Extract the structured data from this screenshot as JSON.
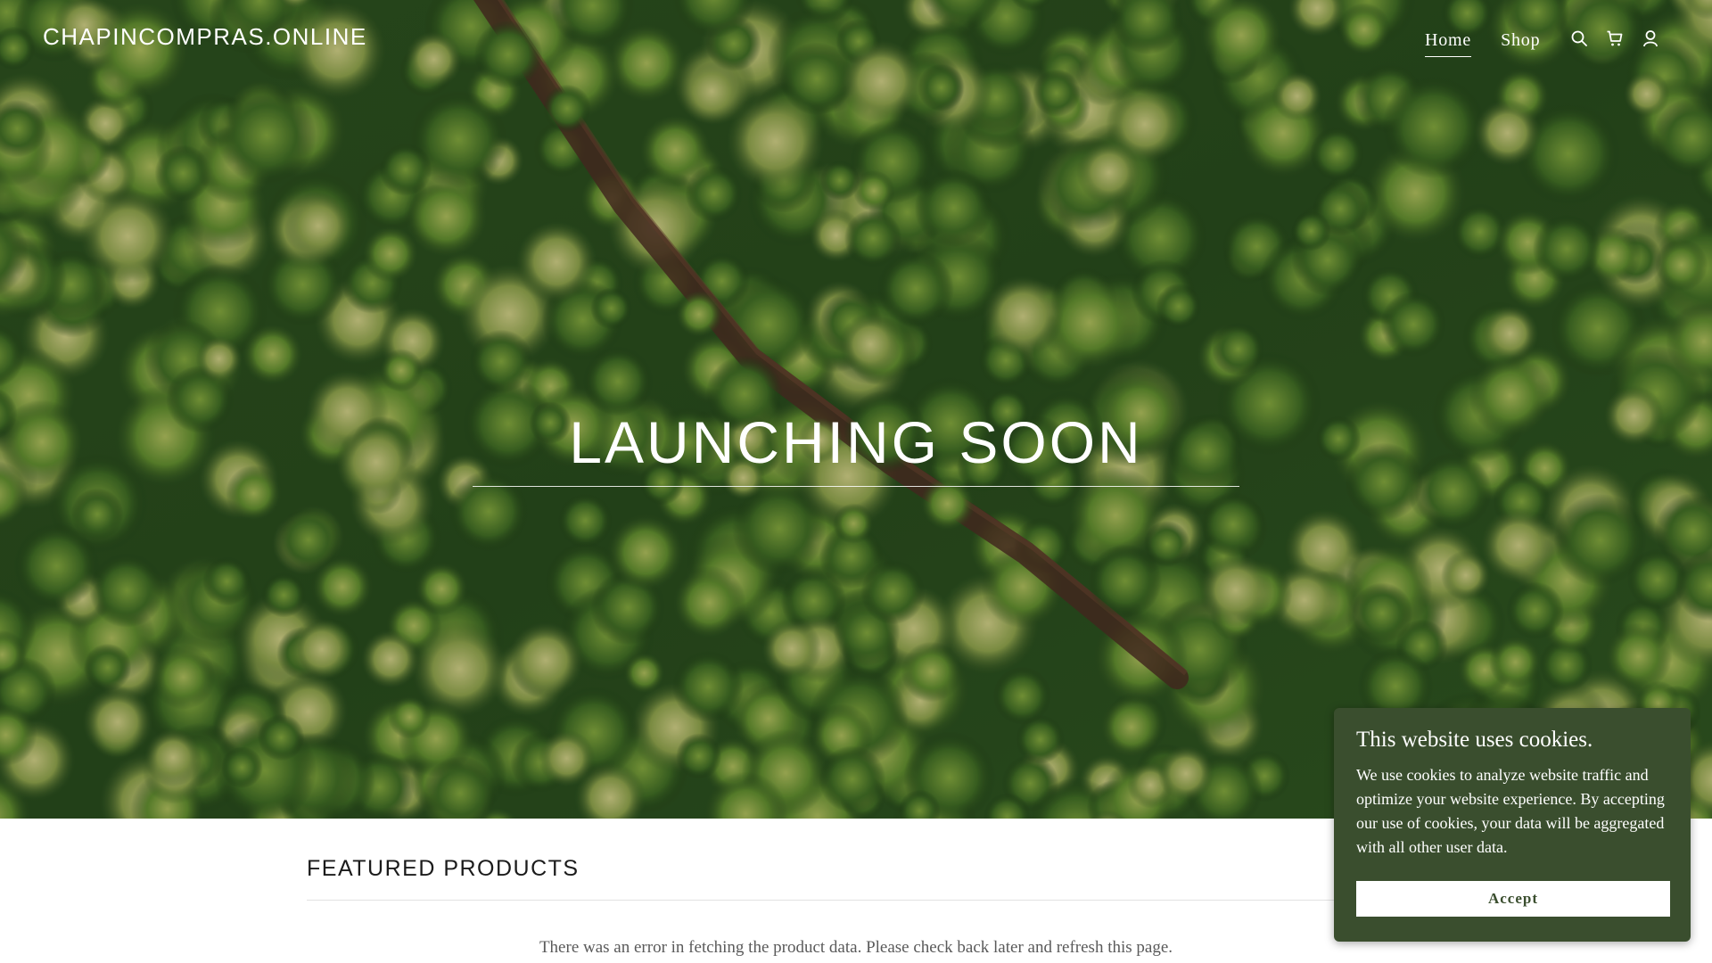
{
  "header": {
    "logo": "CHAPINCOMPRAS.ONLINE",
    "nav": [
      {
        "label": "Home",
        "active": true
      },
      {
        "label": "Shop",
        "active": false
      }
    ],
    "icons": [
      "search-icon",
      "cart-icon",
      "account-icon"
    ]
  },
  "hero": {
    "title": "LAUNCHING SOON"
  },
  "featured": {
    "title": "FEATURED PRODUCTS",
    "error": "There was an error in fetching the product data. Please check back later and refresh this page."
  },
  "cookie": {
    "title": "This website uses cookies.",
    "text": "We use cookies to analyze website traffic and optimize your website experience. By accepting our use of cookies, your data will be aggregated with all other user data.",
    "button": "Accept"
  },
  "colors": {
    "forest": "#23461f",
    "cookie_bg": "#3a4e2e"
  }
}
